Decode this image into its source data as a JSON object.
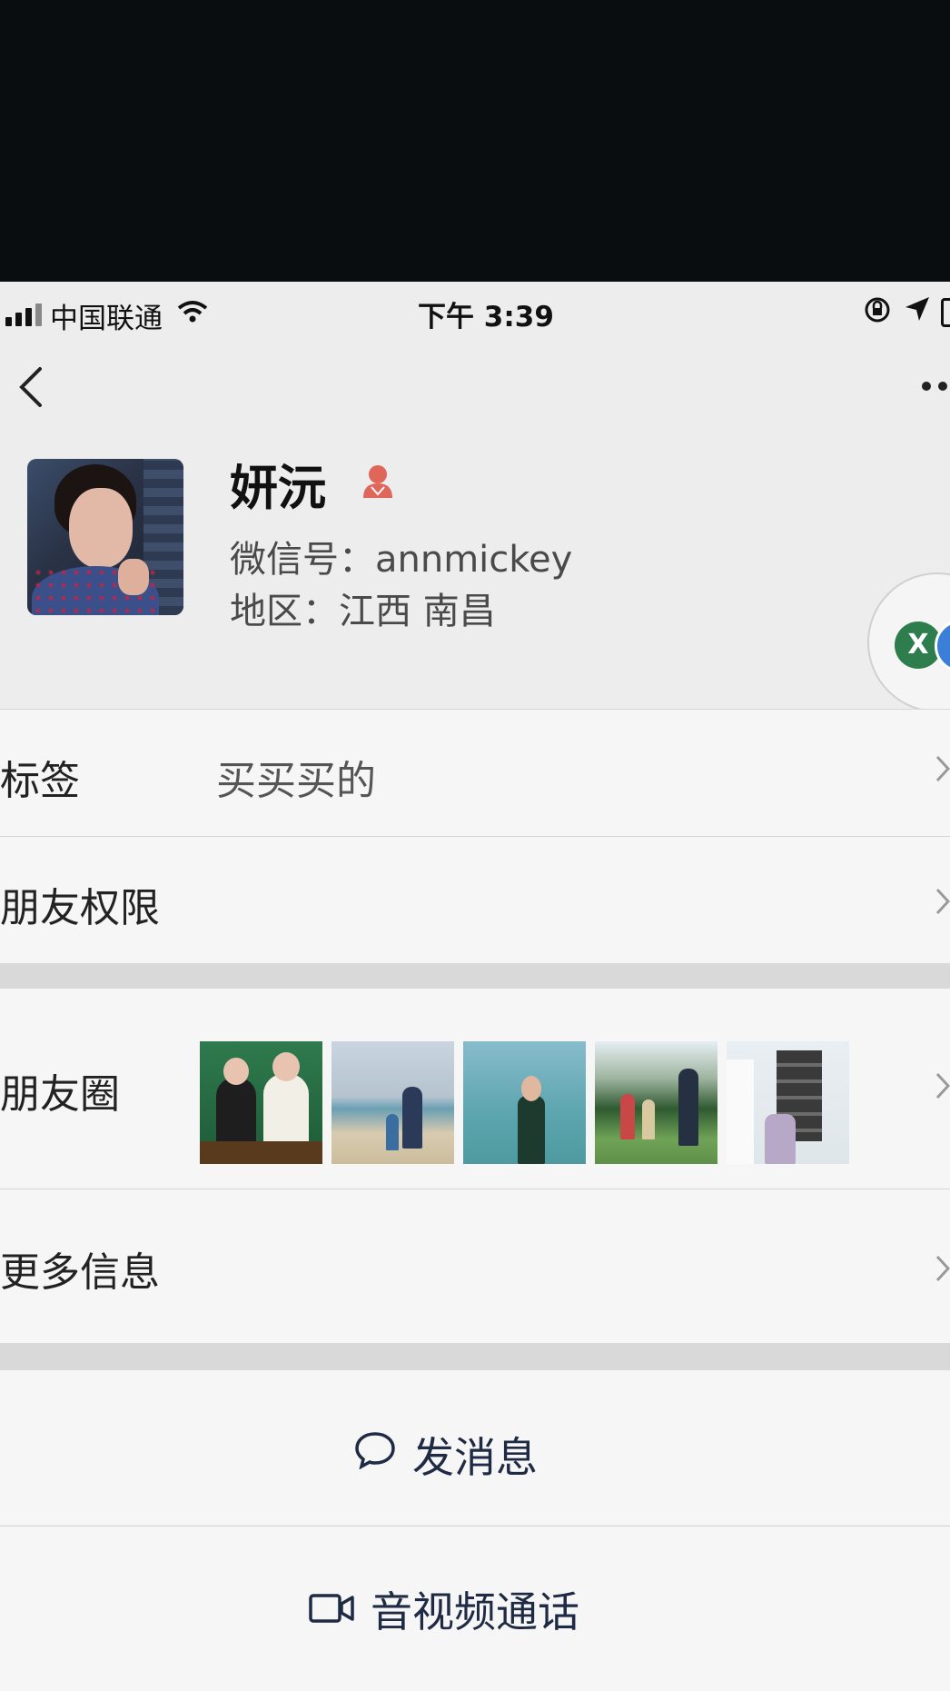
{
  "status_bar": {
    "carrier": "中国联通",
    "time": "下午 3:39"
  },
  "profile": {
    "name": "妍沅",
    "wechat_id": "微信号：annmickey",
    "region": "地区：江西 南昌"
  },
  "rows": {
    "tags_label": "标签",
    "tags_value": "买买买的",
    "permissions_label": "朋友权限",
    "moments_label": "朋友圈",
    "more_info_label": "更多信息"
  },
  "actions": {
    "send_message": "发消息",
    "video_call": "音视频通话"
  },
  "colors": {
    "accent_text": "#1f2a44",
    "female_icon": "#e0665a",
    "background": "#ededed"
  }
}
